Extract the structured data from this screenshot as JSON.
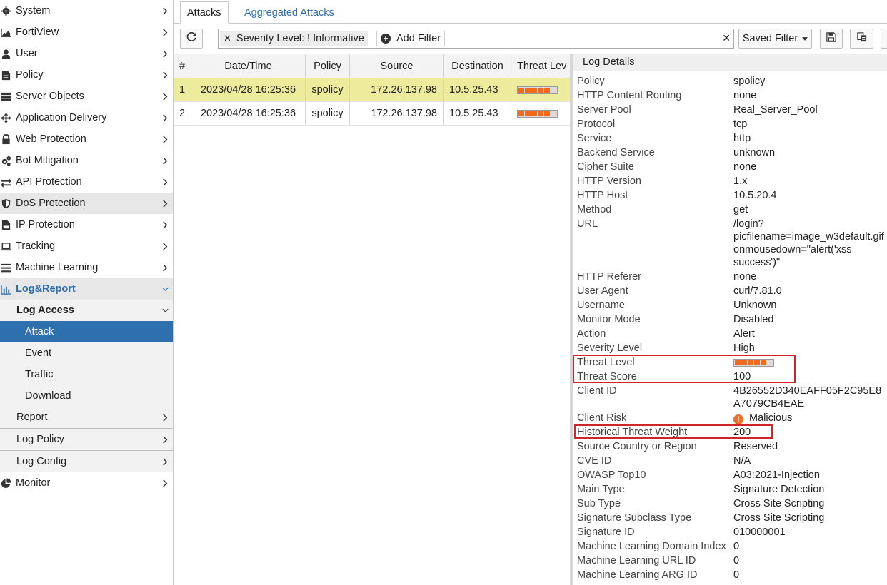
{
  "sidebar": {
    "items": [
      {
        "label": "System",
        "icon": "gear-icon"
      },
      {
        "label": "FortiView",
        "icon": "area-chart-icon"
      },
      {
        "label": "User",
        "icon": "user-icon"
      },
      {
        "label": "Policy",
        "icon": "policy-icon"
      },
      {
        "label": "Server Objects",
        "icon": "server-icon"
      },
      {
        "label": "Application Delivery",
        "icon": "arrows-icon"
      },
      {
        "label": "Web Protection",
        "icon": "lock-icon"
      },
      {
        "label": "Bot Mitigation",
        "icon": "cogs-icon"
      },
      {
        "label": "API Protection",
        "icon": "exchange-icon"
      },
      {
        "label": "DoS Protection",
        "icon": "shield-icon"
      },
      {
        "label": "IP Protection",
        "icon": "ip-icon"
      },
      {
        "label": "Tracking",
        "icon": "laptop-icon"
      },
      {
        "label": "Machine Learning",
        "icon": "bars-icon"
      },
      {
        "label": "Log&Report",
        "icon": "bar-chart-icon"
      }
    ],
    "log_access": "Log Access",
    "log_access_items": [
      "Attack",
      "Event",
      "Traffic",
      "Download"
    ],
    "report": "Report",
    "log_policy": "Log Policy",
    "log_config": "Log Config",
    "monitor": "Monitor"
  },
  "tabs": [
    "Attacks",
    "Aggregated Attacks"
  ],
  "toolbar": {
    "filter_chip": "Severity Level:  ! Informative",
    "add_filter": "Add Filter",
    "saved_filter": "Saved Filter"
  },
  "table": {
    "headers": [
      "#",
      "Date/Time",
      "Policy",
      "Source",
      "Destination",
      "Threat Lev"
    ],
    "rows": [
      {
        "num": "1",
        "datetime": "2023/04/28 16:25:36",
        "policy": "spolicy",
        "source": "172.26.137.98",
        "destination": "10.5.25.43",
        "threat_level": 5
      },
      {
        "num": "2",
        "datetime": "2023/04/28 16:25:36",
        "policy": "spolicy",
        "source": "172.26.137.98",
        "destination": "10.5.25.43",
        "threat_level": 5
      }
    ],
    "threat_level_max": 6
  },
  "details": {
    "title": "Log Details",
    "rows": [
      {
        "k": "Policy",
        "v": "spolicy"
      },
      {
        "k": "HTTP Content Routing",
        "v": "none"
      },
      {
        "k": "Server Pool",
        "v": "Real_Server_Pool"
      },
      {
        "k": "Protocol",
        "v": "tcp"
      },
      {
        "k": "Service",
        "v": "http"
      },
      {
        "k": "Backend Service",
        "v": "unknown"
      },
      {
        "k": "Cipher Suite",
        "v": "none"
      },
      {
        "k": "HTTP Version",
        "v": "1.x"
      },
      {
        "k": "HTTP Host",
        "v": "10.5.20.4"
      },
      {
        "k": "Method",
        "v": "get"
      },
      {
        "k": "URL",
        "v": "/login?\npicfilename=image_w3default.gif\nonmousedown=\"alert('xss\nsuccess')\""
      },
      {
        "k": "HTTP Referer",
        "v": "none"
      },
      {
        "k": "User Agent",
        "v": "curl/7.81.0"
      },
      {
        "k": "Username",
        "v": "Unknown"
      },
      {
        "k": "Monitor Mode",
        "v": "Disabled"
      },
      {
        "k": "Action",
        "v": "Alert"
      },
      {
        "k": "Severity Level",
        "v": "High"
      },
      {
        "k": "Threat Level",
        "v": ""
      },
      {
        "k": "Threat Score",
        "v": "100"
      },
      {
        "k": "Client ID",
        "v": "4B26552D340EAFF05F2C95E8\nA7079CB4EAE"
      },
      {
        "k": "Client Risk",
        "v": "Malicious"
      },
      {
        "k": "Historical Threat Weight",
        "v": "200"
      },
      {
        "k": "Source Country or Region",
        "v": "Reserved"
      },
      {
        "k": "CVE ID",
        "v": "N/A"
      },
      {
        "k": "OWASP Top10",
        "v": "A03:2021-Injection"
      },
      {
        "k": "Main Type",
        "v": "Signature Detection"
      },
      {
        "k": "Sub Type",
        "v": "Cross Site Scripting"
      },
      {
        "k": "Signature Subclass Type",
        "v": "Cross Site Scripting"
      },
      {
        "k": "Signature ID",
        "v": "010000001"
      },
      {
        "k": "Machine Learning Domain Index",
        "v": "0"
      },
      {
        "k": "Machine Learning URL ID",
        "v": "0"
      },
      {
        "k": "Machine Learning ARG ID",
        "v": "0"
      }
    ],
    "threat_level": 5,
    "colors": {
      "accent": "#2e6fae",
      "threat": "#f26b1d",
      "highlight": "#d0232a",
      "selected_row": "#edeb9c"
    }
  }
}
